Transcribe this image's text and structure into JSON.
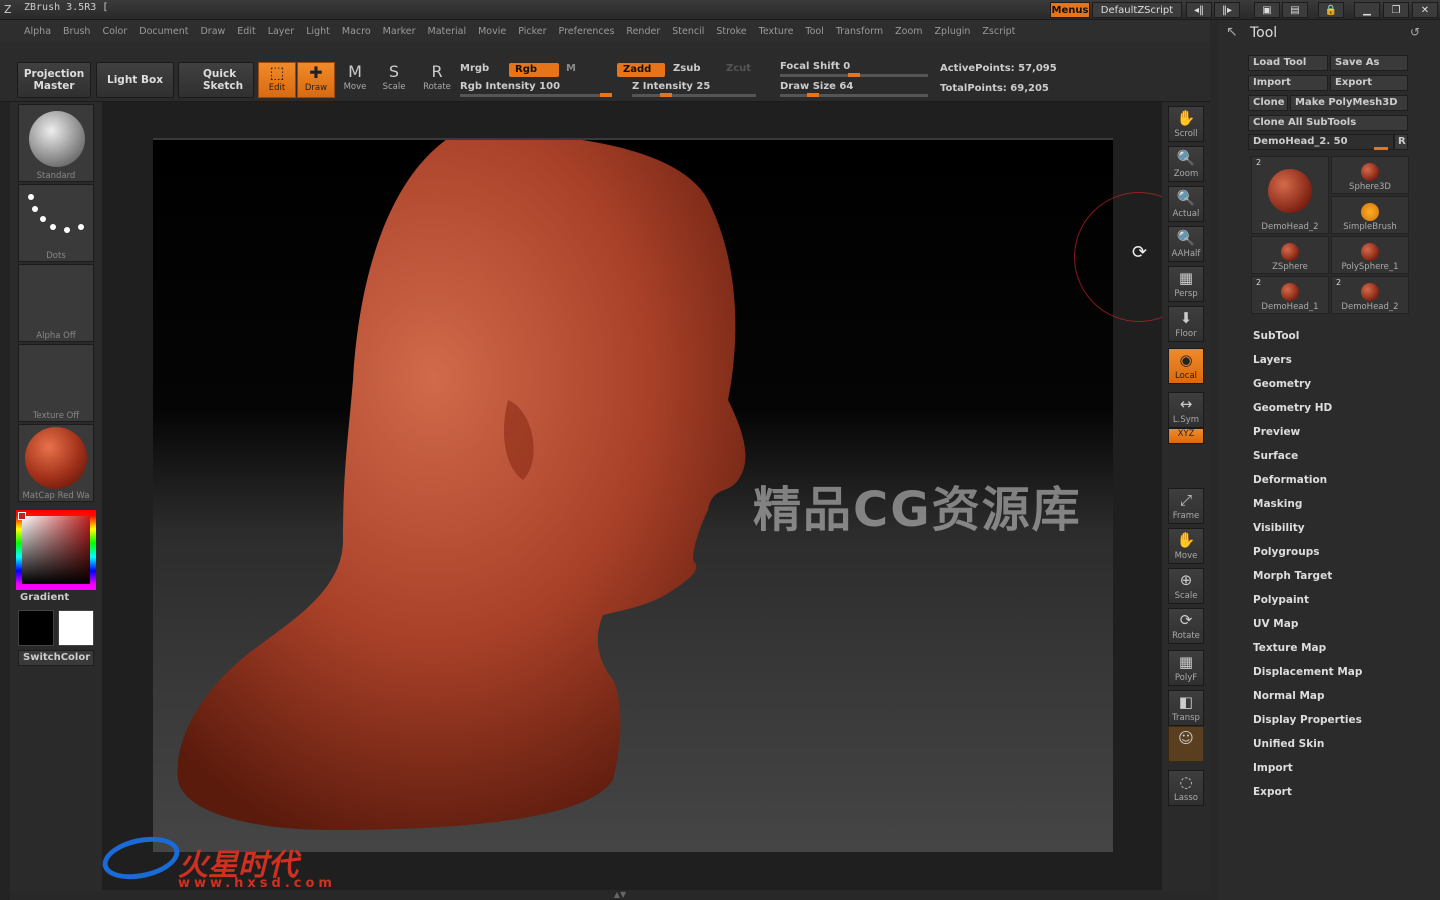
{
  "app": {
    "title": "ZBrush 3.5R3 [",
    "menus_label": "Menus",
    "script_label": "DefaultZScript"
  },
  "menubar": [
    "Alpha",
    "Brush",
    "Color",
    "Document",
    "Draw",
    "Edit",
    "Layer",
    "Light",
    "Macro",
    "Marker",
    "Material",
    "Movie",
    "Picker",
    "Preferences",
    "Render",
    "Stencil",
    "Stroke",
    "Texture",
    "Tool",
    "Transform",
    "Zoom",
    "Zplugin",
    "Zscript"
  ],
  "shelf": {
    "projection_master": "Projection Master",
    "light_box": "Light Box",
    "quick_sketch": "Quick Sketch",
    "tools": [
      {
        "label": "Edit",
        "glyph": "⬚",
        "on": true
      },
      {
        "label": "Draw",
        "glyph": "✚",
        "on": true
      },
      {
        "label": "Move",
        "glyph": "M",
        "on": false
      },
      {
        "label": "Scale",
        "glyph": "S",
        "on": false
      },
      {
        "label": "Rotate",
        "glyph": "R",
        "on": false
      }
    ],
    "mrgb": "Mrgb",
    "rgb": "Rgb",
    "m": "M",
    "zadd": "Zadd",
    "zsub": "Zsub",
    "zcut": "Zcut",
    "rgb_intensity": "Rgb Intensity 100",
    "z_intensity": "Z Intensity 25",
    "focal_shift": "Focal Shift 0",
    "draw_size": "Draw Size 64",
    "active_points": "ActivePoints: 57,095",
    "total_points": "TotalPoints: 69,205",
    "rgb_intensity_value": 1.0,
    "z_intensity_value": 0.25,
    "focal_shift_value": 0.5,
    "draw_size_value": 0.2
  },
  "left": {
    "standard": "Standard",
    "dots": "Dots",
    "alpha": "Alpha  Off",
    "texture": "Texture  Off",
    "matcap": "MatCap  Red  Wa",
    "gradient": "Gradient",
    "switch_color": "SwitchColor"
  },
  "right_shelf": [
    {
      "label": "Scroll",
      "glyph": "✋"
    },
    {
      "label": "Zoom",
      "glyph": "🔍"
    },
    {
      "label": "Actual",
      "glyph": "🔍"
    },
    {
      "label": "AAHalf",
      "glyph": "🔍"
    },
    {
      "label": "Persp",
      "glyph": "▦"
    },
    {
      "label": "Floor",
      "glyph": "⬇"
    },
    {
      "label": "Local",
      "glyph": "◉",
      "on": true
    },
    {
      "label": "L.Sym",
      "glyph": "↔"
    },
    {
      "label": "XYZ",
      "glyph": "⟲",
      "on": true
    },
    {
      "label": "Frame",
      "glyph": "⤢"
    },
    {
      "label": "Move",
      "glyph": "✋"
    },
    {
      "label": "Scale",
      "glyph": "⊕"
    },
    {
      "label": "Rotate",
      "glyph": "⟳"
    },
    {
      "label": "PolyF",
      "glyph": "▦"
    },
    {
      "label": "Transp",
      "glyph": "◧"
    },
    {
      "label": "Ghost",
      "glyph": "☺",
      "dim": true
    },
    {
      "label": "Lasso",
      "glyph": "◌"
    }
  ],
  "tool": {
    "header": "Tool",
    "load_tool": "Load Tool",
    "save_as": "Save As",
    "import": "Import",
    "export": "Export",
    "clone": "Clone",
    "make_polymesh": "Make PolyMesh3D",
    "clone_all": "Clone  All  SubTools",
    "current": "DemoHead_2. 50",
    "r": "R",
    "thumbs": [
      {
        "name": "DemoHead_2",
        "num": "2"
      },
      {
        "name": "Sphere3D",
        "num": ""
      },
      {
        "name": "SimpleBrush",
        "num": ""
      },
      {
        "name": "ZSphere",
        "num": ""
      },
      {
        "name": "PolySphere_1",
        "num": ""
      },
      {
        "name": "DemoHead_1",
        "num": "2"
      },
      {
        "name": "DemoHead_2",
        "num": "2"
      }
    ],
    "sections": [
      "SubTool",
      "Layers",
      "Geometry",
      "Geometry  HD",
      "Preview",
      "Surface",
      "Deformation",
      "Masking",
      "Visibility",
      "Polygroups",
      "Morph  Target",
      "Polypaint",
      "UV  Map",
      "Texture  Map",
      "Displacement  Map",
      "Normal  Map",
      "Display  Properties",
      "Unified  Skin",
      "Import",
      "Export"
    ]
  },
  "watermarks": {
    "center": "精品CG资源库",
    "logo": "火星时代",
    "url": "www.hxsd.com"
  }
}
